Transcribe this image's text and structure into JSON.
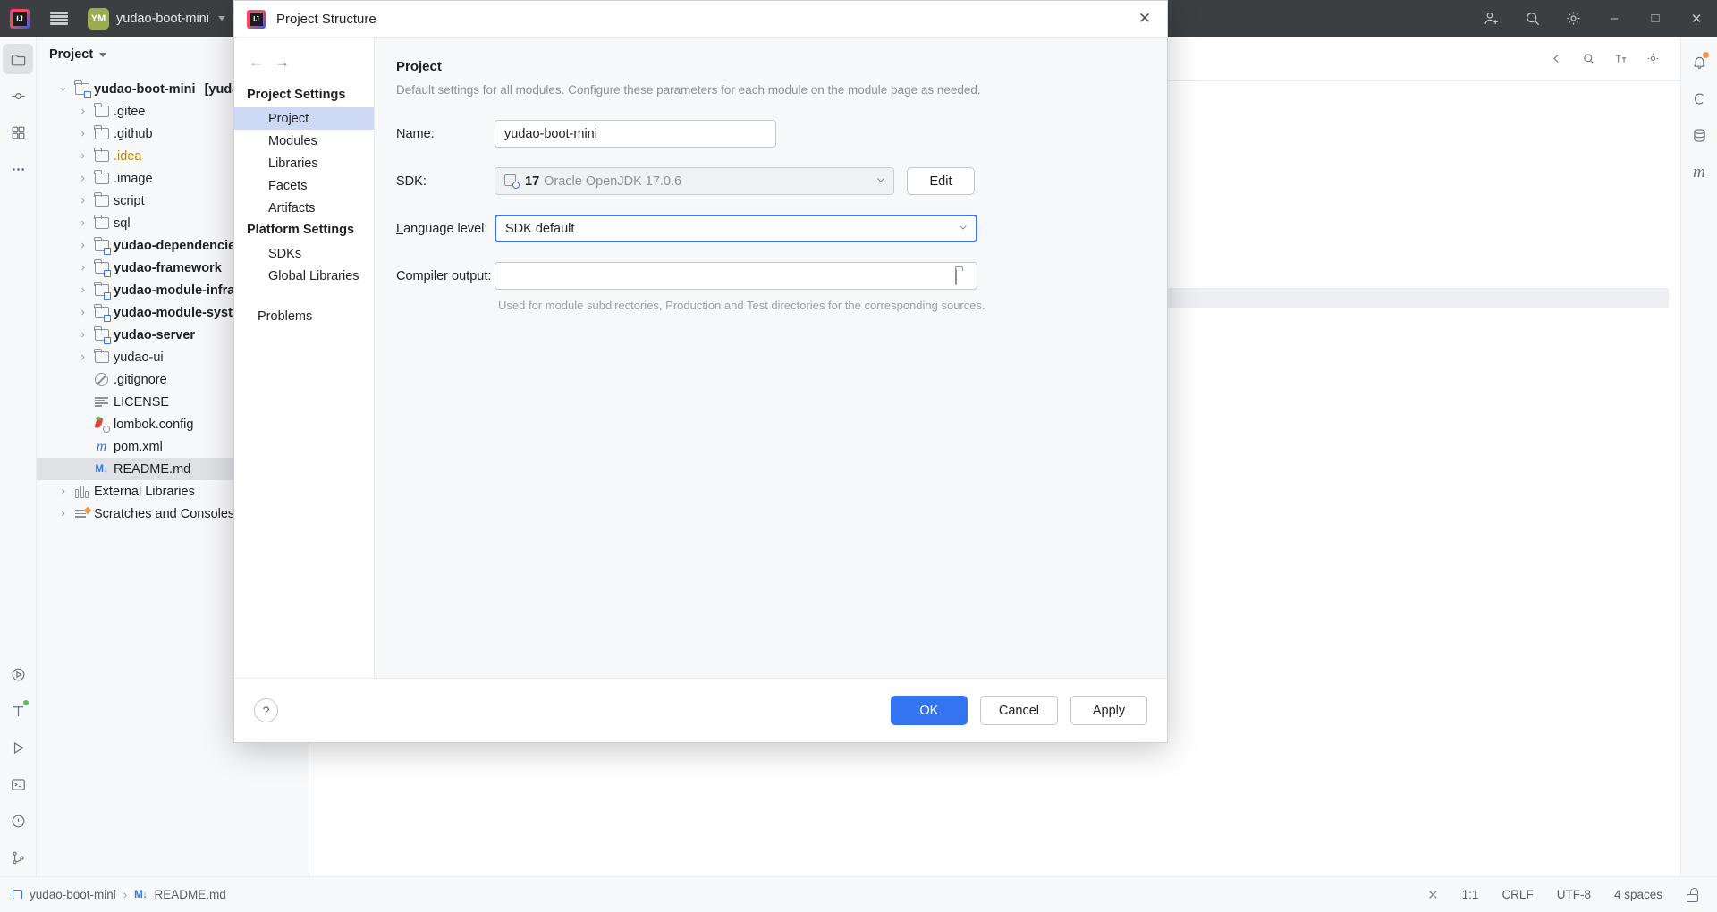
{
  "titlebar": {
    "app_icon": "intellij-logo-icon",
    "menu_icon": "hamburger-menu-icon",
    "project_badge": "YM",
    "project_name": "yudao-boot-mini",
    "icons": [
      "vcs-branch-icon",
      "add-user-icon",
      "search-icon",
      "settings-gear-icon"
    ],
    "window": {
      "minimize": "–",
      "maximize": "□",
      "close": "✕"
    }
  },
  "left_rail": {
    "items": [
      {
        "name": "project-tool-icon",
        "active": true
      },
      {
        "name": "commit-tool-icon",
        "active": false
      },
      {
        "name": "structure-tool-icon",
        "active": false
      },
      {
        "name": "more-tool-windows-icon",
        "active": false
      },
      {
        "name": "run-tool-icon",
        "active": false
      },
      {
        "name": "todo-tool-icon",
        "active": false
      },
      {
        "name": "services-run-icon",
        "active": false
      },
      {
        "name": "terminal-tool-icon",
        "active": false
      },
      {
        "name": "problems-tool-icon",
        "active": false
      },
      {
        "name": "version-control-icon",
        "active": false
      }
    ]
  },
  "right_rail": {
    "items": [
      {
        "name": "notifications-bell-icon"
      },
      {
        "name": "ai-assistant-icon"
      },
      {
        "name": "database-icon"
      },
      {
        "name": "maven-icon"
      }
    ]
  },
  "project_panel": {
    "title": "Project",
    "tree": [
      {
        "label": "yudao-boot-mini",
        "suffix": "[yudao]",
        "icon": "module-folder-icon",
        "depth": 0,
        "twist": "expanded",
        "bold": true,
        "selected": false
      },
      {
        "label": ".gitee",
        "icon": "folder-icon",
        "depth": 1,
        "twist": "collapsed",
        "bold": false,
        "selected": false
      },
      {
        "label": ".github",
        "icon": "folder-icon",
        "depth": 1,
        "twist": "collapsed",
        "bold": false,
        "selected": false
      },
      {
        "label": ".idea",
        "icon": "folder-icon",
        "depth": 1,
        "twist": "collapsed",
        "bold": false,
        "selected": false,
        "excluded": true
      },
      {
        "label": ".image",
        "icon": "folder-icon",
        "depth": 1,
        "twist": "collapsed",
        "bold": false,
        "selected": false
      },
      {
        "label": "script",
        "icon": "folder-icon",
        "depth": 1,
        "twist": "collapsed",
        "bold": false,
        "selected": false
      },
      {
        "label": "sql",
        "icon": "folder-icon",
        "depth": 1,
        "twist": "collapsed",
        "bold": false,
        "selected": false
      },
      {
        "label": "yudao-dependencies",
        "icon": "module-folder-icon",
        "depth": 1,
        "twist": "collapsed",
        "bold": true,
        "selected": false
      },
      {
        "label": "yudao-framework",
        "icon": "module-folder-icon",
        "depth": 1,
        "twist": "collapsed",
        "bold": true,
        "selected": false
      },
      {
        "label": "yudao-module-infra",
        "icon": "module-folder-icon",
        "depth": 1,
        "twist": "collapsed",
        "bold": true,
        "selected": false
      },
      {
        "label": "yudao-module-system",
        "icon": "module-folder-icon",
        "depth": 1,
        "twist": "collapsed",
        "bold": true,
        "selected": false
      },
      {
        "label": "yudao-server",
        "icon": "module-folder-icon",
        "depth": 1,
        "twist": "collapsed",
        "bold": true,
        "selected": false
      },
      {
        "label": "yudao-ui",
        "icon": "folder-icon",
        "depth": 1,
        "twist": "collapsed",
        "bold": false,
        "selected": false
      },
      {
        "label": ".gitignore",
        "icon": "gitignore-icon",
        "depth": 1,
        "twist": "none",
        "bold": false,
        "selected": false
      },
      {
        "label": "LICENSE",
        "icon": "text-file-icon",
        "depth": 1,
        "twist": "none",
        "bold": false,
        "selected": false
      },
      {
        "label": "lombok.config",
        "icon": "lombok-config-icon",
        "depth": 1,
        "twist": "none",
        "bold": false,
        "selected": false
      },
      {
        "label": "pom.xml",
        "icon": "maven-pom-icon",
        "depth": 1,
        "twist": "none",
        "bold": false,
        "selected": false
      },
      {
        "label": "README.md",
        "icon": "markdown-file-icon",
        "depth": 1,
        "twist": "none",
        "bold": false,
        "selected": true
      },
      {
        "label": "External Libraries",
        "icon": "external-libraries-icon",
        "depth": 0,
        "twist": "collapsed",
        "bold": false,
        "selected": false
      },
      {
        "label": "Scratches and Consoles",
        "icon": "scratches-icon",
        "depth": 0,
        "twist": "collapsed",
        "bold": false,
        "selected": false
      }
    ]
  },
  "editor_toolbar": {
    "icons": [
      "close-tab-icon",
      "preview-icon",
      "font-size-icon",
      "settings-icon"
    ]
  },
  "dialog": {
    "title": "Project Structure",
    "logo_icon": "intellij-logo-icon",
    "close_icon": "close-icon",
    "nav": {
      "back_icon": "arrow-left-icon",
      "forward_icon": "arrow-right-icon",
      "sections": [
        {
          "heading": "Project Settings",
          "items": [
            {
              "label": "Project",
              "selected": true
            },
            {
              "label": "Modules",
              "selected": false
            },
            {
              "label": "Libraries",
              "selected": false
            },
            {
              "label": "Facets",
              "selected": false
            },
            {
              "label": "Artifacts",
              "selected": false
            }
          ]
        },
        {
          "heading": "Platform Settings",
          "items": [
            {
              "label": "SDKs",
              "selected": false
            },
            {
              "label": "Global Libraries",
              "selected": false
            }
          ]
        },
        {
          "heading": "",
          "items": [
            {
              "label": "Problems",
              "selected": false
            }
          ]
        }
      ]
    },
    "main": {
      "heading": "Project",
      "subtitle": "Default settings for all modules. Configure these parameters for each module on the module page as needed.",
      "fields": {
        "name_label": "Name:",
        "name_value": "yudao-boot-mini",
        "sdk_label": "SDK:",
        "sdk_icon": "jdk-icon",
        "sdk_version": "17",
        "sdk_vendor": "Oracle OpenJDK 17.0.6",
        "sdk_edit_button": "Edit",
        "language_level_label": "Language level:",
        "language_level_value": "SDK default",
        "compiler_output_label": "Compiler output:",
        "compiler_output_value": "",
        "compiler_output_browse_icon": "folder-icon",
        "compiler_output_hint": "Used for module subdirectories, Production and Test directories for the corresponding sources."
      }
    },
    "footer": {
      "help_label": "?",
      "ok": "OK",
      "cancel": "Cancel",
      "apply": "Apply"
    }
  },
  "statusbar": {
    "breadcrumb": [
      {
        "label": "yudao-boot-mini",
        "icon": "project-icon"
      },
      {
        "label": "README.md",
        "icon": "markdown-file-icon"
      }
    ],
    "separator": "›",
    "close_icon": "✕",
    "caret": "1:1",
    "line_separator": "CRLF",
    "encoding": "UTF-8",
    "indent": "4 spaces",
    "lock_icon": "unlocked-icon"
  },
  "colors": {
    "accent": "#3574f0",
    "titlebar_bg": "#3c3f41",
    "panel_bg": "#f7f8fa",
    "selection": "#cdd9f5",
    "tree_selection": "#dfe1e5",
    "excluded_folder": "#b8860b",
    "project_badge": "#9aab52"
  }
}
